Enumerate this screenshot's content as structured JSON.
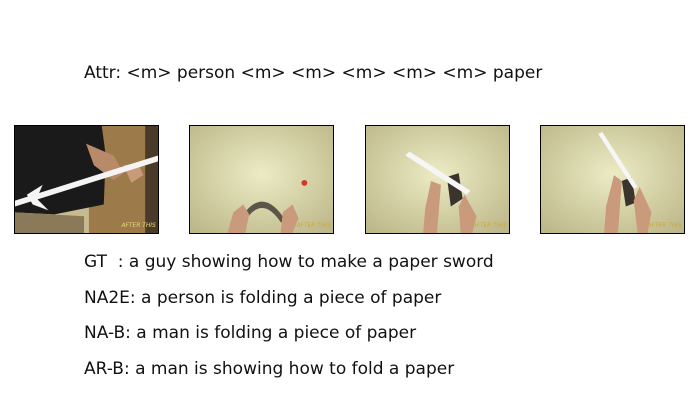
{
  "attr_line": "Attr: <m> person <m> <m> <m> <m> <m> paper",
  "frames": [
    {
      "watermark": "AFTER THIS"
    },
    {
      "watermark": "AFTER THIS"
    },
    {
      "watermark": "AFTER THIS"
    },
    {
      "watermark": "AFTER THIS"
    }
  ],
  "captions": {
    "gt": "GT  : a guy showing how to make a paper sword",
    "na2e": "NA2E: a person is folding a piece of paper",
    "nab": "NA-B: a man is folding a piece of paper",
    "arb": "AR-B: a man is showing how to fold a paper"
  }
}
